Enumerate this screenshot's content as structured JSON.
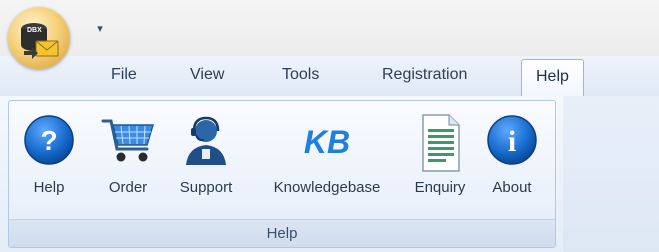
{
  "app": {
    "orb_icon": "app-orb-icon",
    "qat_dropdown": "▾"
  },
  "tabs": [
    {
      "label": "File",
      "active": false
    },
    {
      "label": "View",
      "active": false
    },
    {
      "label": "Tools",
      "active": false
    },
    {
      "label": "Registration",
      "active": false
    },
    {
      "label": "Help",
      "active": true
    }
  ],
  "ribbon": {
    "group_label": "Help",
    "buttons": [
      {
        "label": "Help",
        "icon": "help-icon"
      },
      {
        "label": "Order",
        "icon": "cart-icon"
      },
      {
        "label": "Support",
        "icon": "support-agent-icon"
      },
      {
        "label": "Knowledgebase",
        "icon": "kb-icon",
        "icon_text": "KB"
      },
      {
        "label": "Enquiry",
        "icon": "document-icon"
      },
      {
        "label": "About",
        "icon": "info-icon",
        "icon_text": "i"
      }
    ]
  },
  "colors": {
    "accent_blue": "#1a73d1",
    "ribbon_border": "#b3c8e3"
  }
}
